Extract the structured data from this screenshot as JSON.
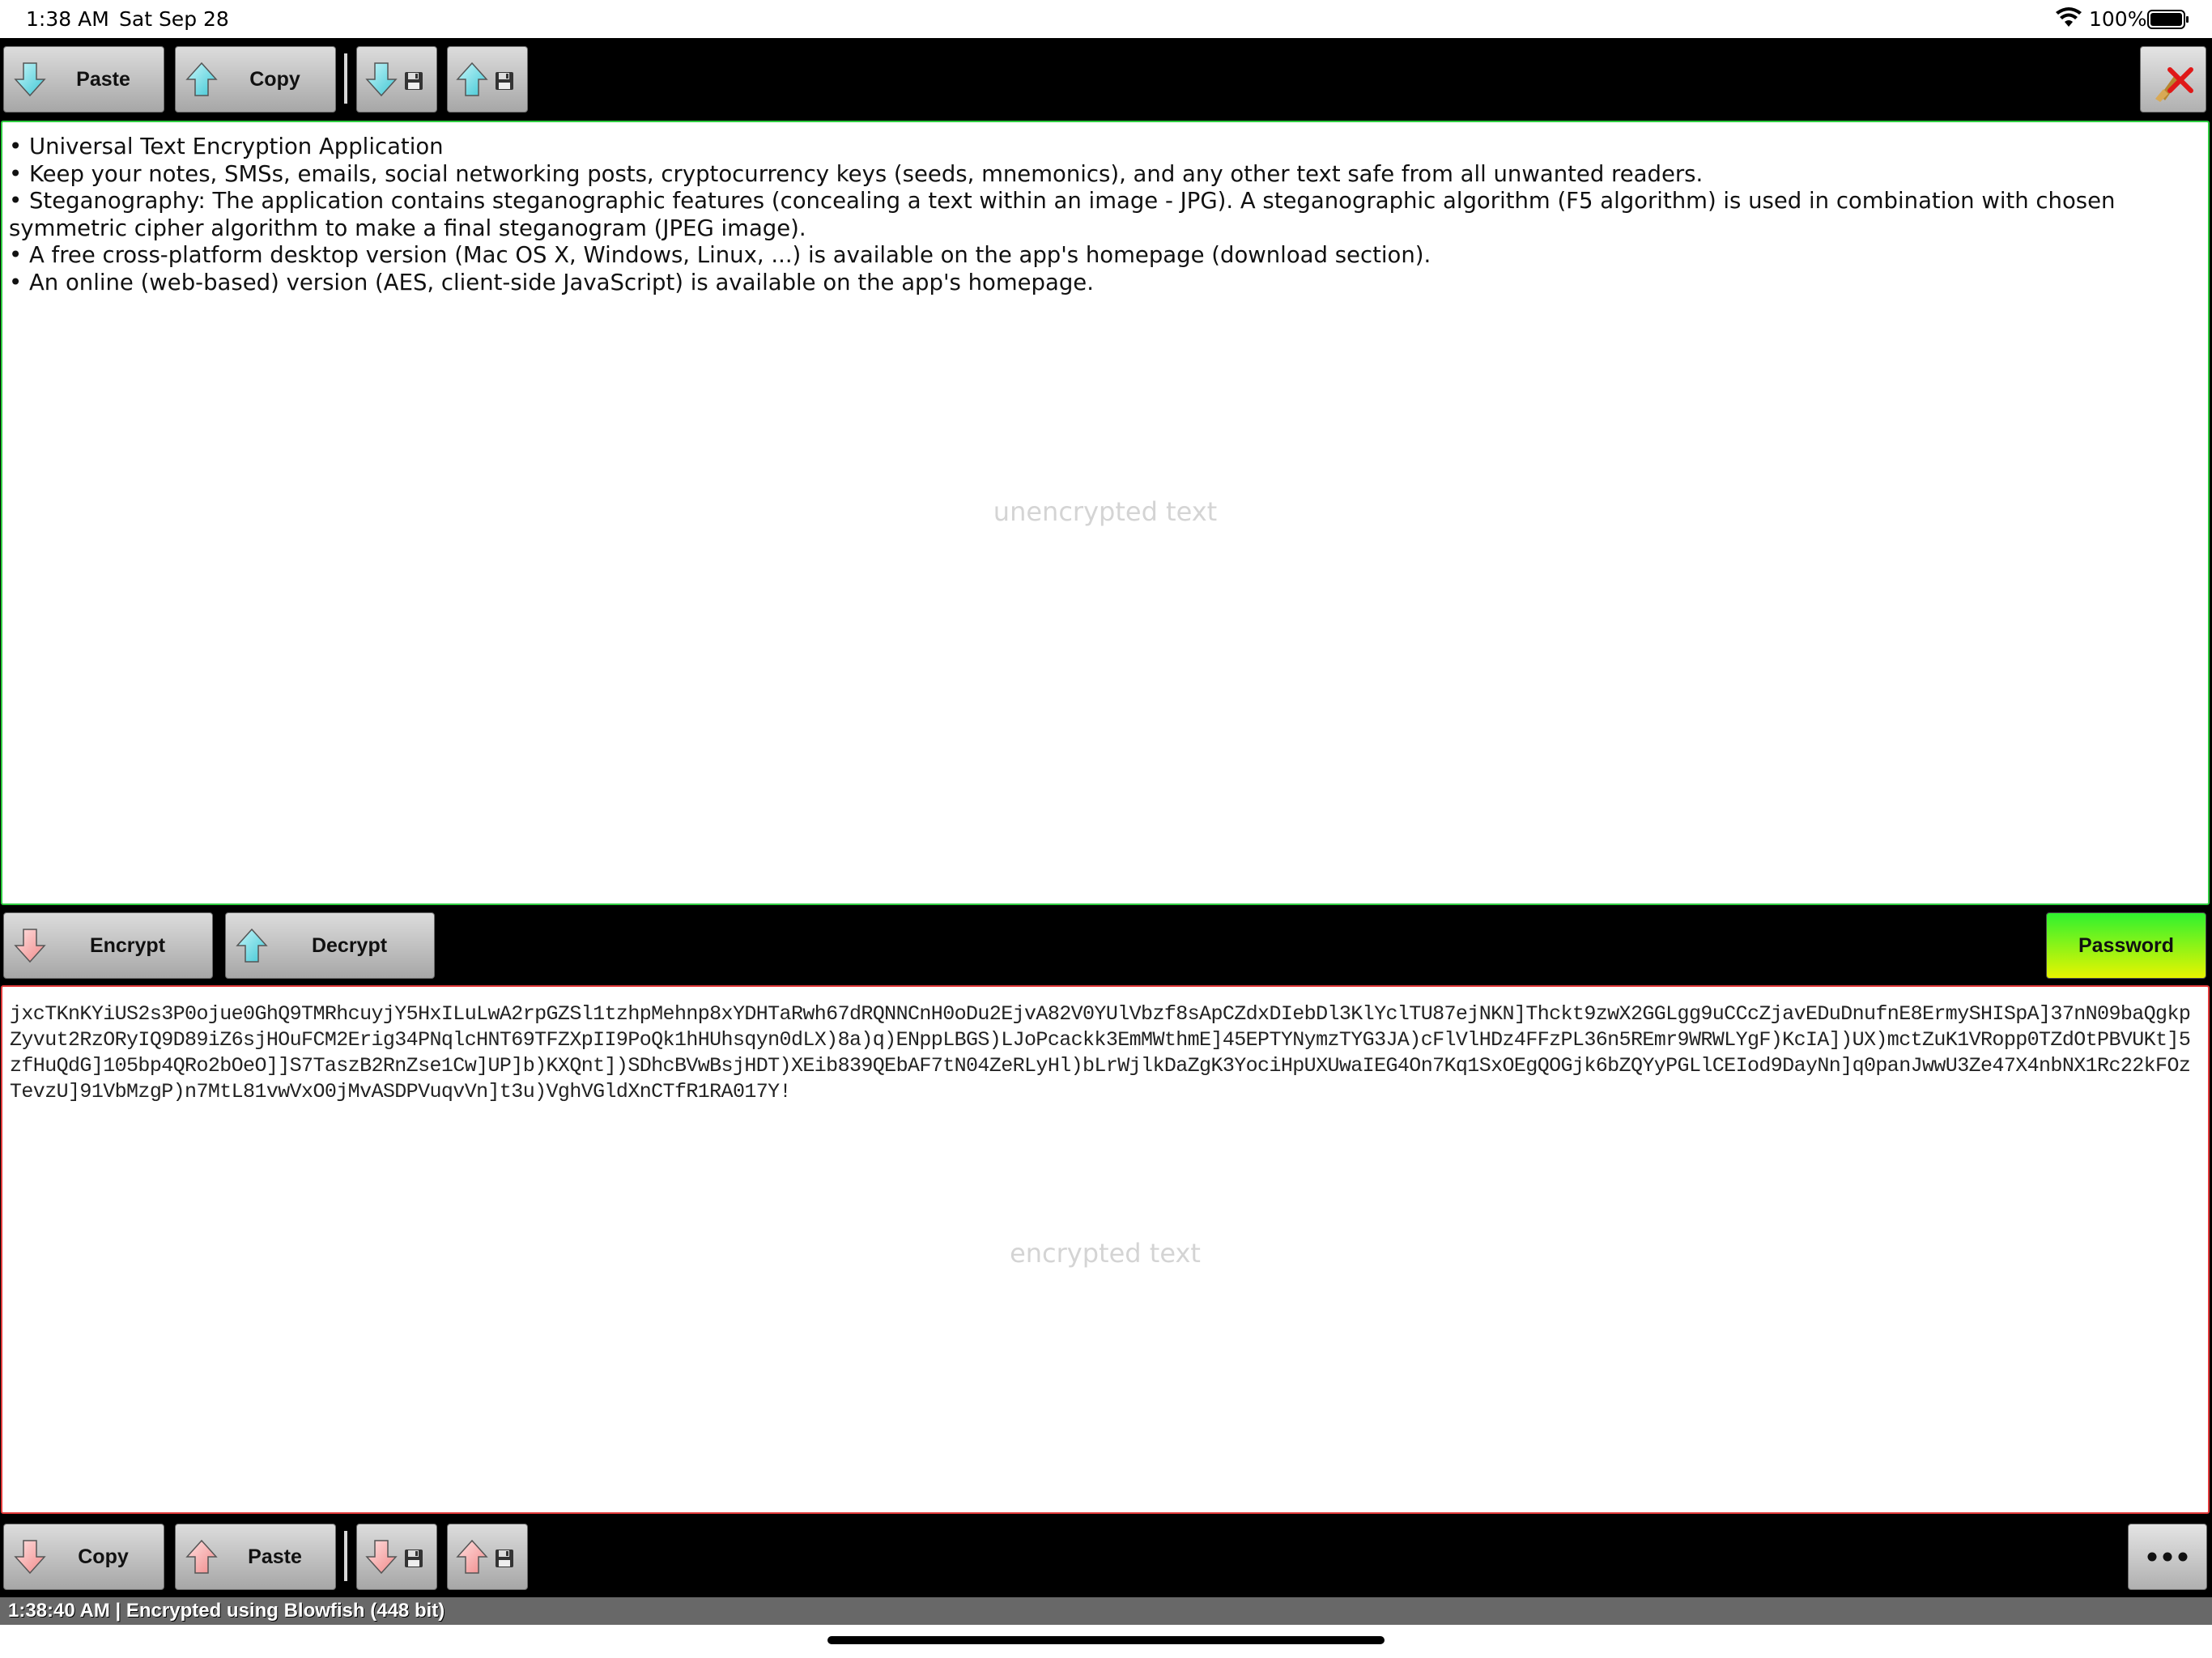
{
  "status_bar": {
    "time": "1:38 AM",
    "date": "Sat Sep 28",
    "battery": "100%"
  },
  "top_toolbar": {
    "paste_label": "Paste",
    "copy_label": "Copy"
  },
  "plain_area": {
    "lines": [
      "• Universal Text Encryption Application",
      "• Keep your notes, SMSs, emails, social networking posts, cryptocurrency keys (seeds, mnemonics), and any other text safe from all unwanted readers.",
      "• Steganography: The application contains steganographic features (concealing a text within an image - JPG). A steganographic algorithm (F5 algorithm) is used in combination with chosen symmetric cipher algorithm to make a final steganogram (JPEG image).",
      "• A free cross-platform desktop version (Mac OS X, Windows, Linux, ...) is available on the app's homepage (download section).",
      "• An online (web-based) version (AES, client-side JavaScript) is available on the app's homepage."
    ],
    "placeholder": "unencrypted text"
  },
  "middle_toolbar": {
    "encrypt_label": "Encrypt",
    "decrypt_label": "Decrypt",
    "password_label": "Password"
  },
  "cipher_area": {
    "text": "jxcTKnKYiUS2s3P0ojue0GhQ9TMRhcuyjY5HxILuLwA2rpGZSl1tzhpMehnp8xYDHTaRwh67dRQNNCnH0oDu2EjvA82V0YUlVbzf8sApCZdxDIebDl3KlYclTU87ejNKN]Thckt9zwX2GGLgg9uCCcZjavEDuDnufnE8ErmySHISpA]37nN09baQgkpZyvut2RzORyIQ9D89iZ6sjHOuFCM2Erig34PNqlcHNT69TFZXpII9PoQk1hHUhsqyn0dLX)8a)q)ENppLBGS)LJoPcackk3EmMWthmE]45EPTYNymzTYG3JA)cFlVlHDz4FFzPL36n5REmr9WRWLYgF)KcIA])UX)mctZuK1VRopp0TZdOtPBVUKt]5zfHuQdG]105bp4QRo2bOeO]]S7TaszB2RnZse1Cw]UP]b)KXQnt])SDhcBVwBsjHDT)XEib839QEbAF7tN04ZeRLyHl)bLrWjlkDaZgK3YociHpUXUwaIEG4On7Kq1SxOEgQOGjk6bZQYyPGLlCEIod9DayNn]q0panJwwU3Ze47X4nbNX1Rc22kFOzTevzU]91VbMzgP)n7MtL81vwVxO0jMvASDPVuqvVn]t3u)VghVGldXnCTfR1RA017Y!",
    "placeholder": "encrypted text"
  },
  "bottom_toolbar": {
    "copy_label": "Copy",
    "paste_label": "Paste"
  },
  "status_line": {
    "text": "1:38:40 AM | Encrypted using Blowfish (448 bit)"
  },
  "colors": {
    "plain_border": "#2ecc40",
    "cipher_border": "#e23a3a",
    "arrow_cyan": "#7fe3ea",
    "arrow_pink": "#f7a8a8"
  },
  "icons": {
    "down_arrow": "down-arrow-icon",
    "up_arrow": "up-arrow-icon",
    "floppy": "floppy-disk-icon",
    "clear": "broom-clear-icon",
    "more": "ellipsis-icon"
  }
}
